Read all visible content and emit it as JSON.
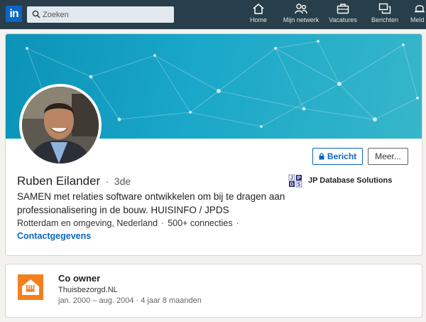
{
  "nav": {
    "logo_text": "in",
    "search_placeholder": "Zoeken",
    "items": [
      {
        "label": "Home",
        "icon": "home-icon"
      },
      {
        "label": "Mijn netwerk",
        "icon": "network-icon"
      },
      {
        "label": "Vacatures",
        "icon": "briefcase-icon"
      },
      {
        "label": "Berichten",
        "icon": "messages-icon"
      },
      {
        "label": "Meld",
        "icon": "bell-icon"
      }
    ]
  },
  "profile": {
    "name": "Ruben Eilander",
    "degree_separator": "·",
    "degree": "3de",
    "headline": "SAMEN met relaties software ontwikkelen om bij te dragen aan professionalisering in de bouw. HUISINFO / JPDS",
    "location": "Rotterdam en omgeving, Nederland",
    "connections": "500+ connecties",
    "separator": "·",
    "contact_label": "Contactgegevens",
    "message_button": "Bericht",
    "more_button": "Meer...",
    "current_company": "JP Database Solutions",
    "company_logo_letters": [
      "J",
      "P",
      "D",
      "S"
    ]
  },
  "experience": [
    {
      "title": "Co owner",
      "company": "Thuisbezorgd.NL",
      "dates": "jan. 2000 – aug. 2004 · 4 jaar 8 maanden"
    }
  ],
  "colors": {
    "nav_bg": "#283e4a",
    "brand_blue": "#0a66c2",
    "banner_teal": "#1aa7c9",
    "thuisbezorgd_orange": "#f47f1f",
    "page_bg": "#f3f2ef"
  }
}
